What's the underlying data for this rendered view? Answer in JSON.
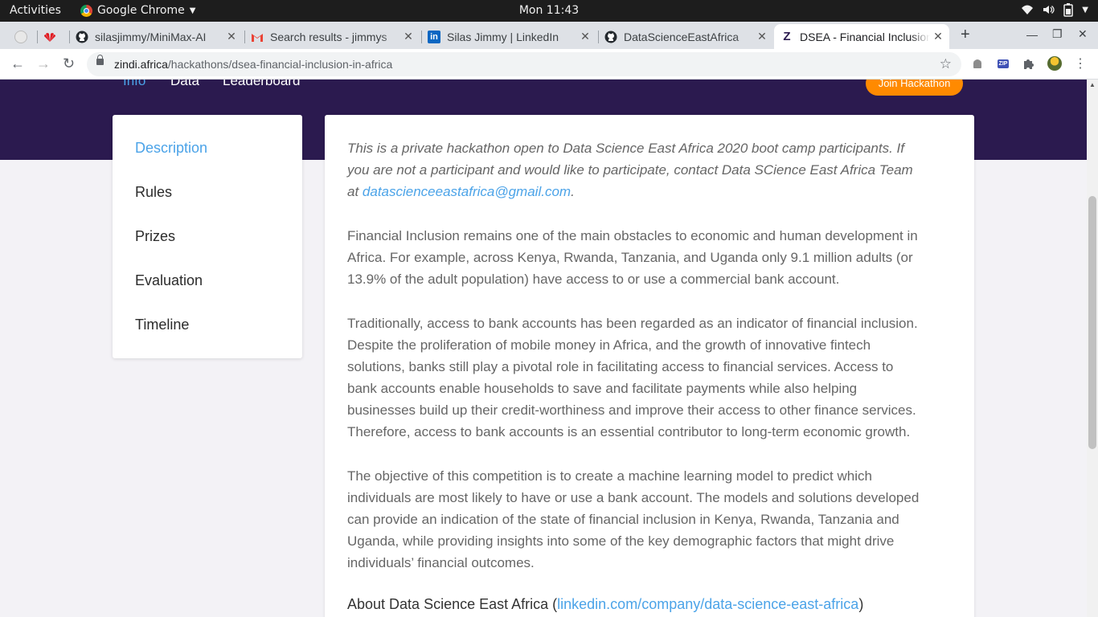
{
  "system_bar": {
    "activities": "Activities",
    "app_name": "Google Chrome",
    "clock": "Mon 11:43"
  },
  "tabs": [
    {
      "title": "",
      "favicon": "blank-circle"
    },
    {
      "title": "",
      "favicon": "huawei-logo"
    },
    {
      "title": "silasjimmy/MiniMax-AI",
      "favicon": "github-icon"
    },
    {
      "title": "Search results - jimmys",
      "favicon": "gmail-icon"
    },
    {
      "title": "Silas Jimmy | LinkedIn",
      "favicon": "linkedin-icon"
    },
    {
      "title": "DataScienceEastAfrica",
      "favicon": "github-icon"
    },
    {
      "title": "DSEA - Financial Inclusion",
      "favicon": "zindi-icon"
    }
  ],
  "address_bar": {
    "host": "zindi.africa",
    "path": "/hackathons/dsea-financial-inclusion-in-africa"
  },
  "page": {
    "subnav": [
      "Info",
      "Data",
      "Leaderboard"
    ],
    "join_button": "Join Hackathon",
    "sidebar": [
      "Description",
      "Rules",
      "Prizes",
      "Evaluation",
      "Timeline"
    ],
    "intro_line1": "This is a private hackathon open to Data Science East Africa 2020 boot camp participants. If",
    "intro_line2": "you are not a participant and would like to participate, contact Data SCience East Africa Team",
    "intro_line3_prefix": "at ",
    "intro_email": "datascienceeastafrica@gmail.com",
    "intro_line3_suffix": ".",
    "p1": [
      "Financial Inclusion remains one of the main obstacles to economic and human development in",
      "Africa. For example, across Kenya, Rwanda, Tanzania, and Uganda only 9.1 million adults (or",
      "13.9% of the adult population) have access to or use a commercial bank account."
    ],
    "p2": [
      "Traditionally, access to bank accounts has been regarded as an indicator of financial inclusion.",
      "Despite the proliferation of mobile money in Africa, and the growth of innovative fintech",
      "solutions, banks still play a pivotal role in facilitating access to financial services. Access to",
      "bank accounts enable households to save and facilitate payments while also helping",
      "businesses build up their credit-worthiness and improve their access to other finance services.",
      "Therefore, access to bank accounts is an essential contributor to long-term economic growth."
    ],
    "p3": [
      "The objective of this competition is to create a machine learning model to predict which",
      "individuals are most likely to have or use a bank account. The models and solutions developed",
      "can provide an indication of the state of financial inclusion in Kenya, Rwanda, Tanzania and",
      "Uganda, while providing insights into some of the key demographic factors that might drive",
      "individuals’ financial outcomes."
    ],
    "about_prefix": "About Data Science East Africa (",
    "about_link": "linkedin.com/company/data-science-east-africa",
    "about_suffix": ")"
  },
  "colors": {
    "hero": "#2b1a4f",
    "accent": "#4ba3e8",
    "join": "#ff8a00"
  }
}
